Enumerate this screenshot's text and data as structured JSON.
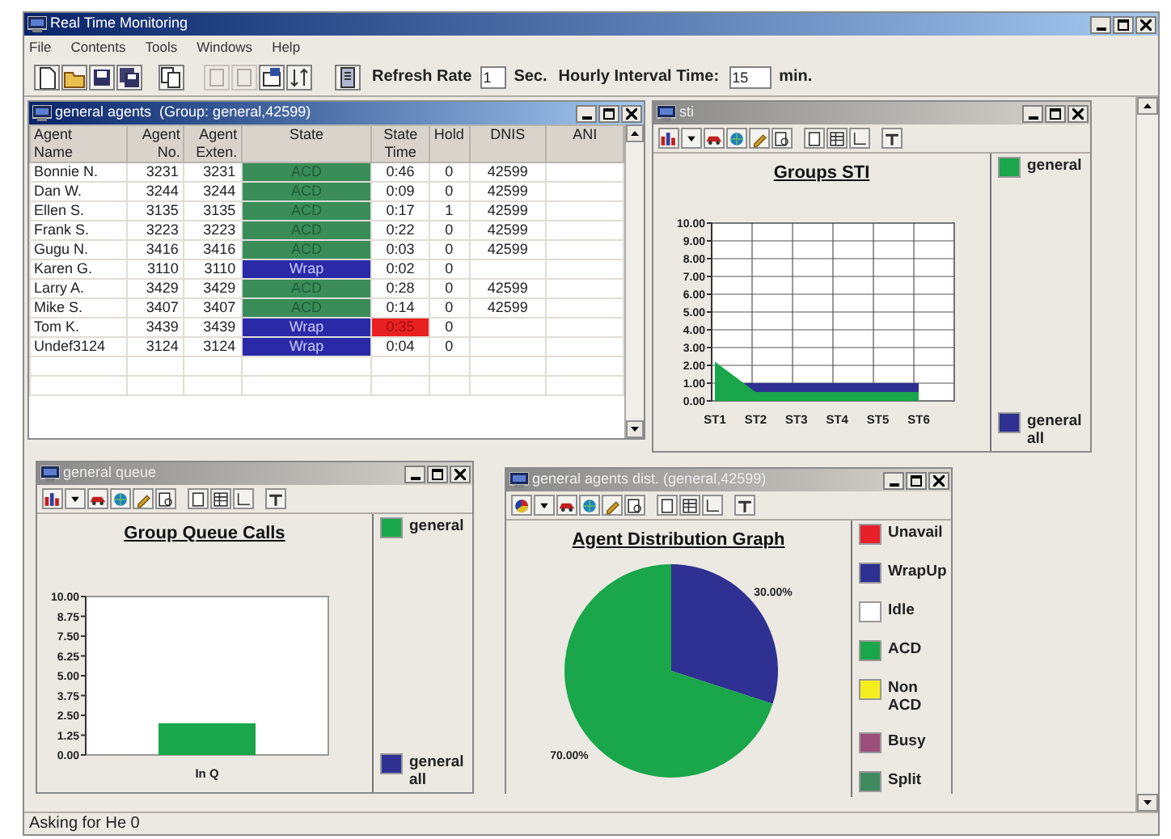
{
  "window": {
    "title": "Real Time Monitoring"
  },
  "menu": [
    "File",
    "Contents",
    "Tools",
    "Windows",
    "Help"
  ],
  "toolbar": {
    "refresh_label": "Refresh Rate",
    "refresh_value": "1",
    "refresh_unit": "Sec.",
    "interval_label": "Hourly Interval Time:",
    "interval_value": "15",
    "interval_unit": "min."
  },
  "agents_window": {
    "title": "general agents  (Group: general,42599)",
    "active": true,
    "columns": [
      "Agent\nName",
      "Agent\nNo.",
      "Agent\nExten.",
      "State",
      "State\nTime",
      "Hold",
      "DNIS",
      "ANI"
    ],
    "rows": [
      {
        "name": "Bonnie N.",
        "agent_no": "3231",
        "extension": "3231",
        "state": "ACD",
        "kind": "acd",
        "state_time": "0:46",
        "time_alert": false,
        "hold": "0",
        "dnis": "42599"
      },
      {
        "name": "Dan W.",
        "agent_no": "3244",
        "extension": "3244",
        "state": "ACD",
        "kind": "acd",
        "state_time": "0:09",
        "time_alert": false,
        "hold": "0",
        "dnis": "42599"
      },
      {
        "name": "Ellen S.",
        "agent_no": "3135",
        "extension": "3135",
        "state": "ACD",
        "kind": "acd",
        "state_time": "0:17",
        "time_alert": false,
        "hold": "1",
        "dnis": "42599"
      },
      {
        "name": "Frank S.",
        "agent_no": "3223",
        "extension": "3223",
        "state": "ACD",
        "kind": "acd",
        "state_time": "0:22",
        "time_alert": false,
        "hold": "0",
        "dnis": "42599"
      },
      {
        "name": "Gugu N.",
        "agent_no": "3416",
        "extension": "3416",
        "state": "ACD",
        "kind": "acd",
        "state_time": "0:03",
        "time_alert": false,
        "hold": "0",
        "dnis": "42599"
      },
      {
        "name": "Karen G.",
        "agent_no": "3110",
        "extension": "3110",
        "state": "Wrap",
        "kind": "wrap",
        "state_time": "0:02",
        "time_alert": false,
        "hold": "0"
      },
      {
        "name": "Larry A.",
        "agent_no": "3429",
        "extension": "3429",
        "state": "ACD",
        "kind": "acd",
        "state_time": "0:28",
        "time_alert": false,
        "hold": "0",
        "dnis": "42599"
      },
      {
        "name": "Mike S.",
        "agent_no": "3407",
        "extension": "3407",
        "state": "ACD",
        "kind": "acd",
        "state_time": "0:14",
        "time_alert": false,
        "hold": "0",
        "dnis": "42599"
      },
      {
        "name": "Tom K.",
        "agent_no": "3439",
        "extension": "3439",
        "state": "Wrap",
        "kind": "wrap",
        "state_time": "0:35",
        "time_alert": true,
        "hold": "0"
      },
      {
        "name": "Undef3124",
        "agent_no": "3124",
        "extension": "3124",
        "state": "Wrap",
        "kind": "wrap",
        "state_time": "0:04",
        "time_alert": false,
        "hold": "0"
      }
    ]
  },
  "sti_window": {
    "title": "sti",
    "active": false,
    "chart_data": {
      "type": "area",
      "title": "Groups STI",
      "categories": [
        "ST1",
        "ST2",
        "ST3",
        "ST4",
        "ST5",
        "ST6"
      ],
      "series": [
        {
          "name": "general",
          "color": "#1aa64a",
          "values": [
            2.2,
            0.5,
            0.5,
            0.5,
            0.5,
            0.5
          ]
        },
        {
          "name": "general all",
          "color": "#2e3192",
          "values": [
            1,
            1,
            1,
            1,
            1,
            1
          ]
        }
      ],
      "ylim": [
        0,
        10
      ],
      "grid": true,
      "yticks": [
        {
          "value": 0,
          "label": "0.00"
        },
        {
          "value": 1,
          "label": "1.00"
        },
        {
          "value": 2,
          "label": "2.00"
        },
        {
          "value": 3,
          "label": "3.00"
        },
        {
          "value": 4,
          "label": "4.00"
        },
        {
          "value": 5,
          "label": "5.00"
        },
        {
          "value": 6,
          "label": "6.00"
        },
        {
          "value": 7,
          "label": "7.00"
        },
        {
          "value": 8,
          "label": "8.00"
        },
        {
          "value": 9,
          "label": "9.00"
        },
        {
          "value": 10,
          "label": "10.00"
        }
      ]
    }
  },
  "queue_window": {
    "title": "general queue",
    "active": false,
    "chart_data": {
      "type": "bar",
      "title": "Group Queue Calls",
      "categories": [
        "In Q"
      ],
      "series": [
        {
          "name": "general",
          "color": "#1aa64a",
          "values": [
            2
          ]
        },
        {
          "name": "general all",
          "color": "#2e3192",
          "values": [
            0
          ]
        }
      ],
      "ylim": [
        0,
        10
      ],
      "yticks": [
        {
          "value": 0,
          "label": "0.00"
        },
        {
          "value": 1.25,
          "label": "1.25"
        },
        {
          "value": 2.5,
          "label": "2.50"
        },
        {
          "value": 3.75,
          "label": "3.75"
        },
        {
          "value": 5,
          "label": "5.00"
        },
        {
          "value": 6.25,
          "label": "6.25"
        },
        {
          "value": 7.5,
          "label": "7.50"
        },
        {
          "value": 8.75,
          "label": "8.75"
        },
        {
          "value": 10,
          "label": "10.00"
        }
      ]
    }
  },
  "dist_window": {
    "title": "general agents dist. (general,42599)",
    "active": false,
    "chart_data": {
      "type": "pie",
      "title": "Agent Distribution Graph",
      "categories": [
        "Unavail",
        "WrapUp",
        "Idle",
        "ACD",
        "Non ACD",
        "Busy",
        "Split"
      ],
      "colors": [
        "#e8202a",
        "#2e3192",
        "#ffffff",
        "#1aa64a",
        "#f5ee1e",
        "#9b4f7a",
        "#3f8a5e"
      ],
      "values": [
        0,
        30,
        0,
        70,
        0,
        0,
        0
      ],
      "value_labels": [
        null,
        "30.00%",
        null,
        "70.00%",
        null,
        null,
        null
      ]
    }
  },
  "status_bar": "Asking for He 0"
}
